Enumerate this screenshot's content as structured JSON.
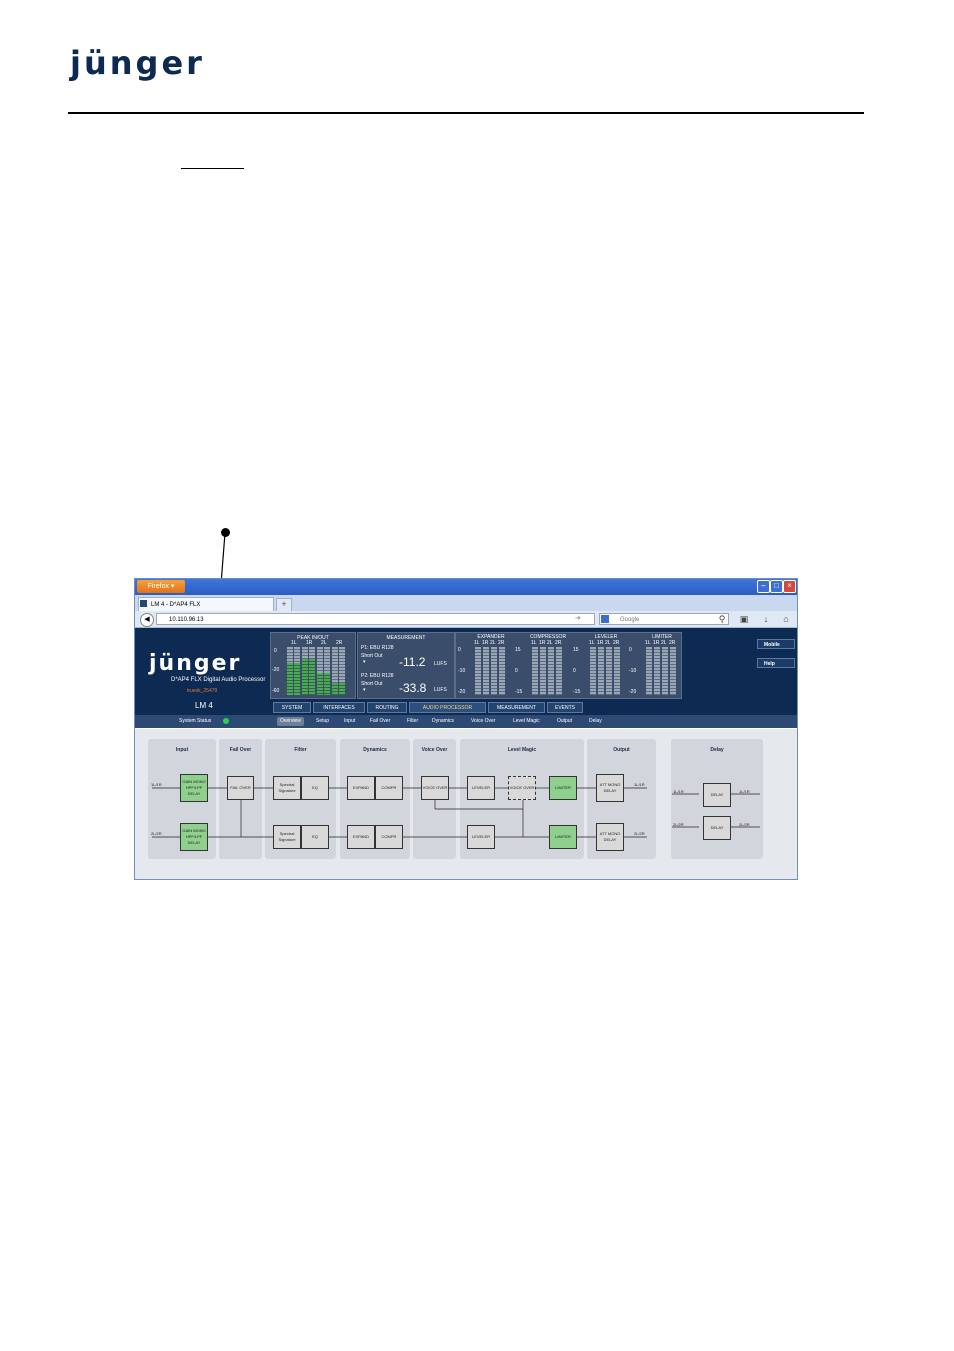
{
  "doc": {
    "logo": "jünger"
  },
  "browser": {
    "app_button": "Firefox",
    "tab_title": "LM 4 - D*AP4 FLX",
    "new_tab": "+",
    "url": "10.110.96.13",
    "search_placeholder": "Google"
  },
  "app": {
    "logo": "jünger",
    "product": "D*AP4 FLX  Digital Audio Processor",
    "device_id": "truesk_25479",
    "device_name": "LM 4",
    "system_status": "System Status",
    "side_buttons": [
      "Mobile",
      "Help"
    ],
    "peak": {
      "title": "PEAK IN/OUT",
      "channels": [
        "1L",
        "1R",
        "2L",
        "2R"
      ],
      "scale": [
        "0",
        "-20",
        "-60"
      ]
    },
    "measurement": {
      "title": "MEASUREMENT",
      "p1": "P1: EBU R128",
      "p1_sub": "Short Out",
      "p1_value": "-11.2",
      "p1_unit": "LUFS",
      "p2": "P2: EBU R128",
      "p2_sub": "Short Out",
      "p2_value": "-33.8",
      "p2_unit": "LUFS"
    },
    "dynamics_meters": [
      {
        "title": "EXPANDER",
        "scale": [
          "0",
          "-10",
          "-20"
        ]
      },
      {
        "title": "COMPRESSOR",
        "scale": [
          "15",
          "0",
          "-15"
        ]
      },
      {
        "title": "LEVELER",
        "scale": [
          "15",
          "0",
          "-15"
        ]
      },
      {
        "title": "LIMITER",
        "scale": [
          "0",
          "-10",
          "-20"
        ]
      }
    ],
    "meter_channels": [
      "1L",
      "1R",
      "2L",
      "2R"
    ],
    "menu": [
      {
        "label": "SYSTEM",
        "active": false
      },
      {
        "label": "INTERFACES",
        "active": false
      },
      {
        "label": "ROUTING",
        "active": false
      },
      {
        "label": "AUDIO PROCESSOR",
        "active": true
      },
      {
        "label": "MEASUREMENT",
        "active": false
      },
      {
        "label": "EVENTS",
        "active": false
      }
    ],
    "submenu": [
      "Overview",
      "Setup",
      "Input",
      "Fail Over",
      "Filter",
      "Dynamics",
      "Voice Over",
      "Level Magic",
      "Output",
      "Delay"
    ]
  },
  "diagram": {
    "panels": [
      "Input",
      "Fail Over",
      "Filter",
      "Dynamics",
      "Voice Over",
      "Level Magic",
      "Output",
      "Delay"
    ],
    "in1": "1L/1R",
    "in2": "2L/2R",
    "gain": "GAIN MONO HPF/LPF DELAY",
    "failover": "FAIL OVER",
    "spectral": "Spectral Signature",
    "eq": "EQ",
    "expand": "EXPAND",
    "compr": "COMPR",
    "voiceover": "VOICE OVER",
    "leveler": "LEVELER",
    "limiter": "LIMITER",
    "att": "ATT MONO DELAY",
    "out1": "1L/1R",
    "out2": "2L/2R",
    "delay": "DELAY"
  }
}
